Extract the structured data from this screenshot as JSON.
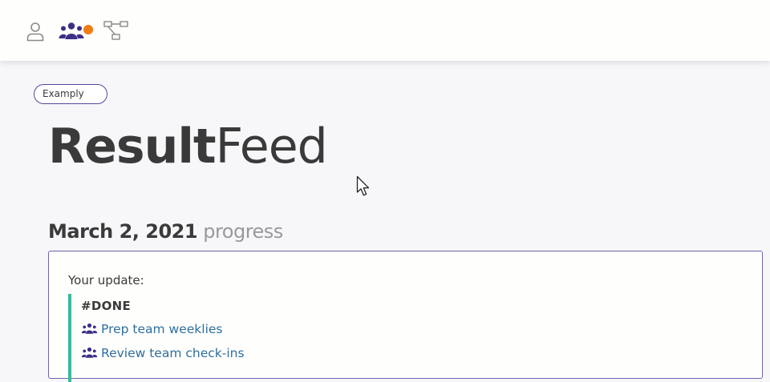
{
  "nav": {
    "items": [
      {
        "icon": "user-icon"
      },
      {
        "icon": "team-icon",
        "active": true,
        "notification": true
      },
      {
        "icon": "hierarchy-icon"
      }
    ],
    "accent_color": "#4a3a8f",
    "notification_color": "#f07c14"
  },
  "workspace_pill": "Examply",
  "title": {
    "bold": "Result",
    "light": "Feed"
  },
  "section": {
    "date": "March 2, 2021",
    "suffix": "progress"
  },
  "update": {
    "label": "Your update:",
    "tag": "#DONE",
    "items": [
      {
        "icon": "team-icon",
        "text": "Prep team weeklies"
      },
      {
        "icon": "team-icon",
        "text": "Review team check-ins"
      }
    ]
  }
}
